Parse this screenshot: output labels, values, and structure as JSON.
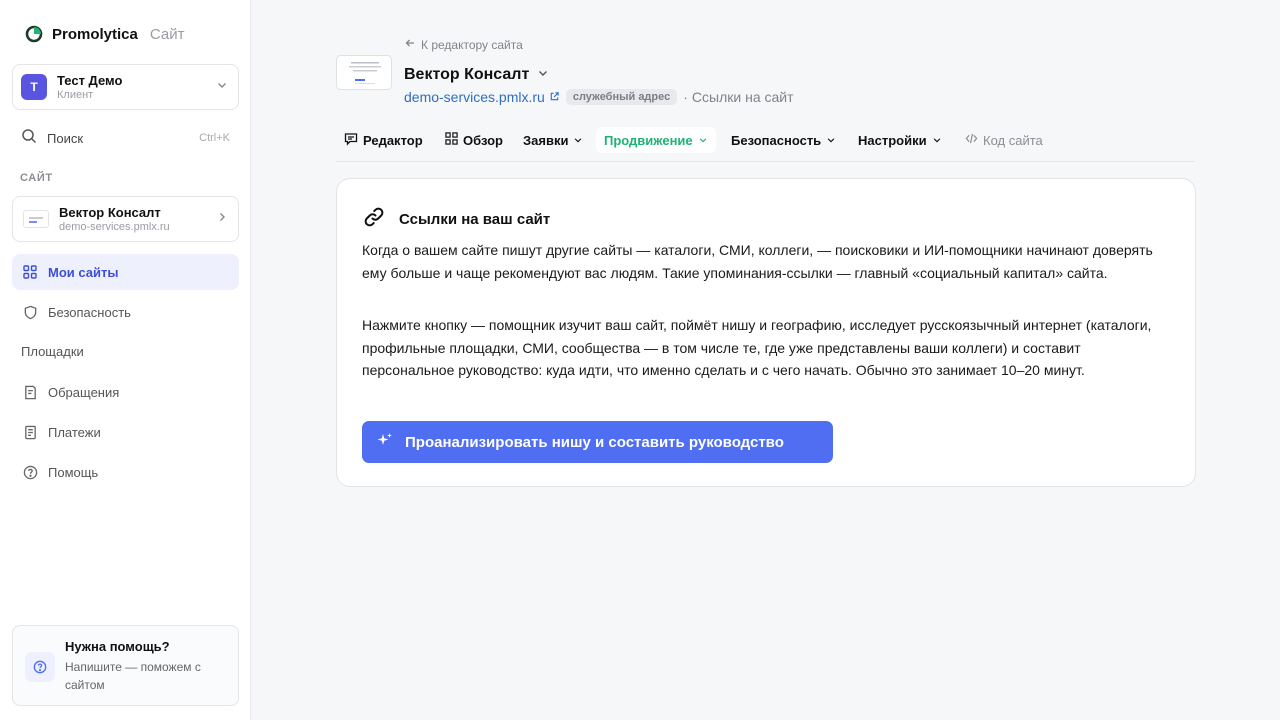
{
  "brand": {
    "name": "Promolytica",
    "suffix": "Сайт"
  },
  "account": {
    "initial": "Т",
    "name": "Тест Демо",
    "role": "Клиент"
  },
  "search": {
    "label": "Поиск",
    "shortcut": "Ctrl+K"
  },
  "sidebar": {
    "section_label": "САЙТ",
    "site": {
      "name": "Вектор Консалт",
      "url": "demo-services.pmlx.ru"
    },
    "items": [
      {
        "label": "Мои сайты",
        "icon": "grid-icon",
        "active": true
      },
      {
        "label": "Безопасность",
        "icon": "shield-icon"
      },
      {
        "label": "Площадки"
      },
      {
        "label": "Обращения",
        "icon": "ticket-icon"
      },
      {
        "label": "Платежи",
        "icon": "receipt-icon"
      },
      {
        "label": "Помощь",
        "icon": "question-icon"
      }
    ],
    "help": {
      "title": "Нужна помощь?",
      "text": "Напишите — поможем с сайтом"
    }
  },
  "header": {
    "back_label": "К редактору сайта",
    "title": "Вектор Консалт",
    "url": "demo-services.pmlx.ru",
    "badge": "служебный адрес",
    "separator": "·",
    "section": "Ссылки на сайт"
  },
  "tabs": [
    {
      "label": "Редактор"
    },
    {
      "label": "Обзор"
    },
    {
      "label": "Заявки"
    },
    {
      "label": "Продвижение",
      "active": true
    },
    {
      "label": "Безопасность"
    },
    {
      "label": "Настройки"
    },
    {
      "label": "Код сайта"
    }
  ],
  "card": {
    "title": "Ссылки на ваш сайт",
    "paragraph1": "Когда о вашем сайте пишут другие сайты — каталоги, СМИ, коллеги, — поисковики и ИИ-помощники начинают доверять ему больше и чаще рекомендуют вас людям. Такие упоминания-ссылки — главный «социальный капитал» сайта.",
    "paragraph2": "Нажмите кнопку — помощник изучит ваш сайт, поймёт нишу и географию, исследует русскоязычный интернет (каталоги, профильные площадки, СМИ, сообщества — в том числе те, где уже представлены ваши коллеги) и составит персональное руководство: куда идти, что именно сделать и с чего начать. Обычно это занимает 10–20 минут.",
    "cta_label": "Проанализировать нишу и составить руководство"
  },
  "colors": {
    "accent": "#4f6ef2",
    "active_nav": "#3f4fd4",
    "active_tab": "#1fb374",
    "avatar": "#5a55e0"
  }
}
